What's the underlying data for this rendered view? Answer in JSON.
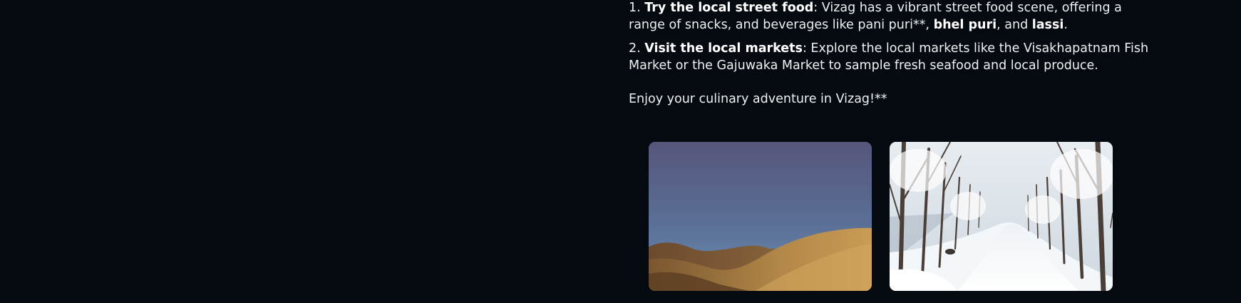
{
  "message": {
    "items": [
      {
        "number": "1. ",
        "title": "Try the local street food",
        "text_a": ": Vizag has a vibrant street food scene, offering a range of snacks, and beverages like pani puri**, ",
        "bold_a": "bhel puri",
        "text_b": ", and ",
        "bold_b": "lassi",
        "text_c": "."
      },
      {
        "number": "2. ",
        "title": "Visit the local markets",
        "text_a": ": Explore the local markets like the Visakhapatnam Fish Market or the Gajuwaka Market to sample fresh seafood and local produce."
      }
    ],
    "closing": "Enjoy your culinary adventure in Vizag!**"
  },
  "gallery": {
    "images": [
      {
        "name": "golden-hills-image",
        "subject": "golden hills under a blue sky"
      },
      {
        "name": "snowy-road-image",
        "subject": "snow-covered road lined with bare trees"
      }
    ]
  }
}
